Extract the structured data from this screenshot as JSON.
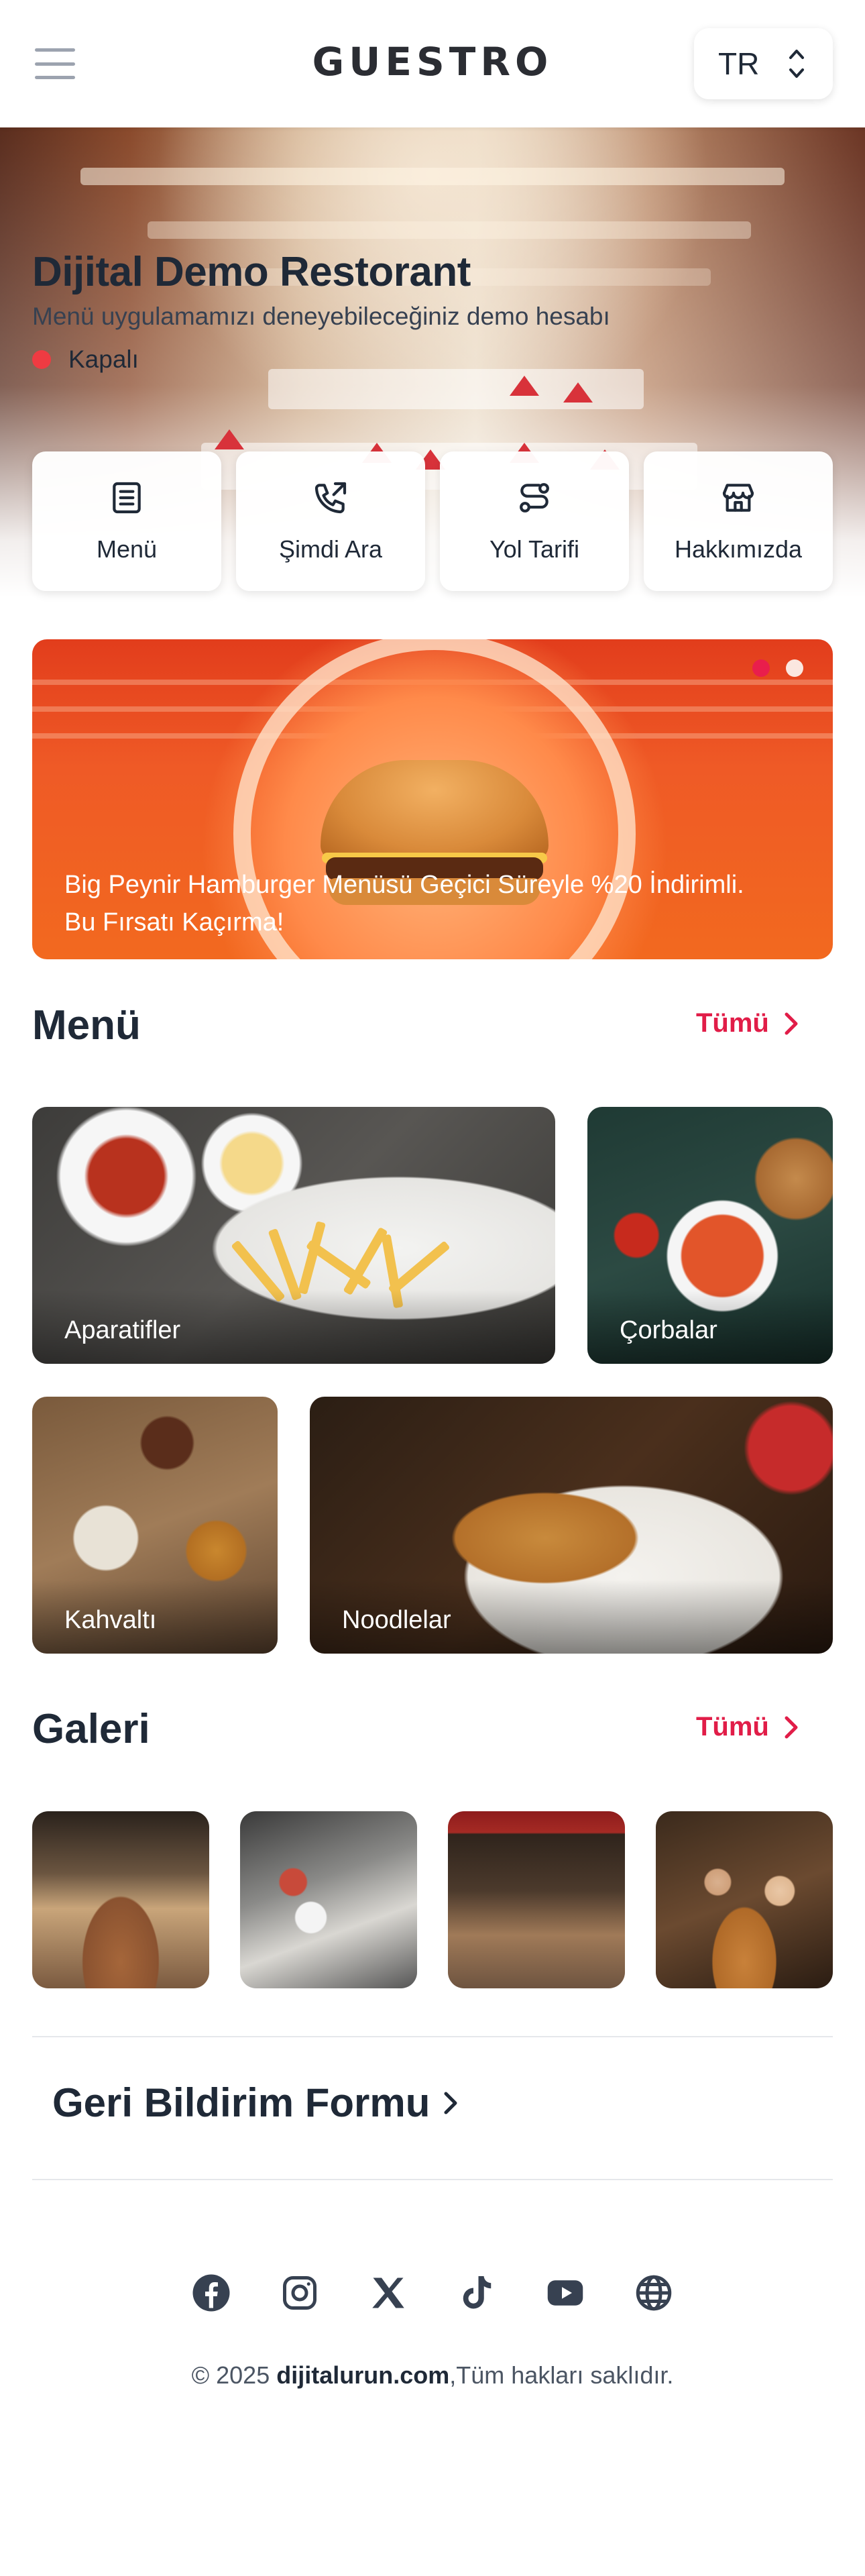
{
  "header": {
    "logo": "GUESTRO",
    "language": "TR",
    "icons": {
      "menu": "hamburger-menu-icon",
      "lang": "chevron-up-down-icon"
    }
  },
  "restaurant": {
    "name": "Dijital Demo Restorant",
    "description": "Menü uygulamamızı deneyebileceğiniz demo hesabı",
    "status": "Kapalı",
    "status_color": "#ef3b42"
  },
  "actions": [
    {
      "label": "Menü",
      "icon": "menu-document-icon"
    },
    {
      "label": "Şimdi Ara",
      "icon": "phone-call-icon"
    },
    {
      "label": "Yol Tarifi",
      "icon": "route-icon"
    },
    {
      "label": "Hakkımızda",
      "icon": "store-icon"
    }
  ],
  "banner": {
    "text": "Big Peynir Hamburger Menüsü Geçici Süreyle %20 İndirimli. Bu Fırsatı Kaçırma!",
    "slides": 2,
    "active_slide": 1
  },
  "menu_section": {
    "title": "Menü",
    "all_label": "Tümü",
    "categories": [
      {
        "label": "Aparatifler"
      },
      {
        "label": "Çorbalar"
      },
      {
        "label": "Kahvaltı"
      },
      {
        "label": "Noodlelar"
      }
    ]
  },
  "gallery_section": {
    "title": "Galeri",
    "all_label": "Tümü",
    "count": 4
  },
  "feedback": {
    "label": "Geri Bildirim Formu"
  },
  "social": [
    "facebook-icon",
    "instagram-icon",
    "x-icon",
    "tiktok-icon",
    "youtube-icon",
    "globe-icon"
  ],
  "footer": {
    "year": "© 2025",
    "brand": "dijitalurun.com",
    "rights": ",Tüm hakları saklıdır."
  },
  "colors": {
    "accent": "#e11d48",
    "text": "#1f2937",
    "status_closed": "#ef3b42"
  }
}
